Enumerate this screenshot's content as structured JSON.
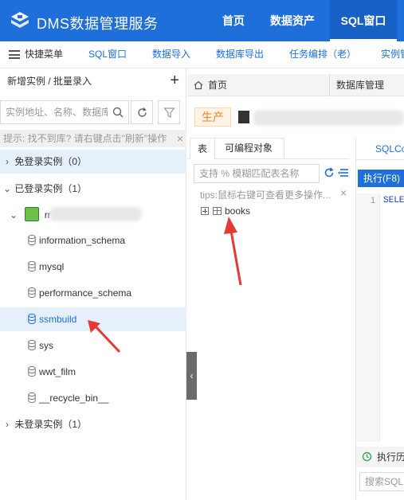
{
  "app": {
    "title": "DMS数据管理服务"
  },
  "topnav": [
    {
      "label": "首页"
    },
    {
      "label": "数据资产"
    },
    {
      "label": "SQL窗口"
    }
  ],
  "menubar": {
    "quick_menu": "快捷菜单",
    "items": [
      "SQL窗口",
      "数据导入",
      "数据库导出",
      "任务编排（老）",
      "实例管"
    ]
  },
  "left_panel": {
    "header": "新增实例 / 批量录入",
    "search_placeholder": "实例地址、名称、数据库",
    "hint": "提示: 找不到库? 请右键点击\"刷新\"操作",
    "groups": [
      {
        "label": "免登录实例（0）",
        "expanded": false
      },
      {
        "label": "已登录实例（1）",
        "expanded": true
      },
      {
        "label": "未登录实例（1）",
        "expanded": false
      }
    ],
    "instance_label": "rr",
    "databases": [
      "information_schema",
      "mysql",
      "performance_schema",
      "ssmbuild",
      "sys",
      "wwt_film",
      "__recycle_bin__"
    ],
    "selected_database": "ssmbuild"
  },
  "tabs": [
    {
      "label": "首页"
    },
    {
      "label": "数据库管理"
    }
  ],
  "env_badge": "生产",
  "object_panel": {
    "tabs": [
      "表",
      "可编程对象"
    ],
    "search_placeholder": "支持 % 模糊匹配表名称",
    "tips": "tips:鼠标右键可查看更多操作...",
    "tables": [
      "books"
    ]
  },
  "sql_panel": {
    "tab_label": "SQLConsole",
    "execute_button": "执行(F8)",
    "line_number": "1",
    "code": "SELECT",
    "history_label": "执行历史",
    "history_search": "搜索SQL,"
  },
  "colors": {
    "brand_blue": "#1e6fd9",
    "env_orange": "#f5821f",
    "arrow_red": "#e53935"
  }
}
